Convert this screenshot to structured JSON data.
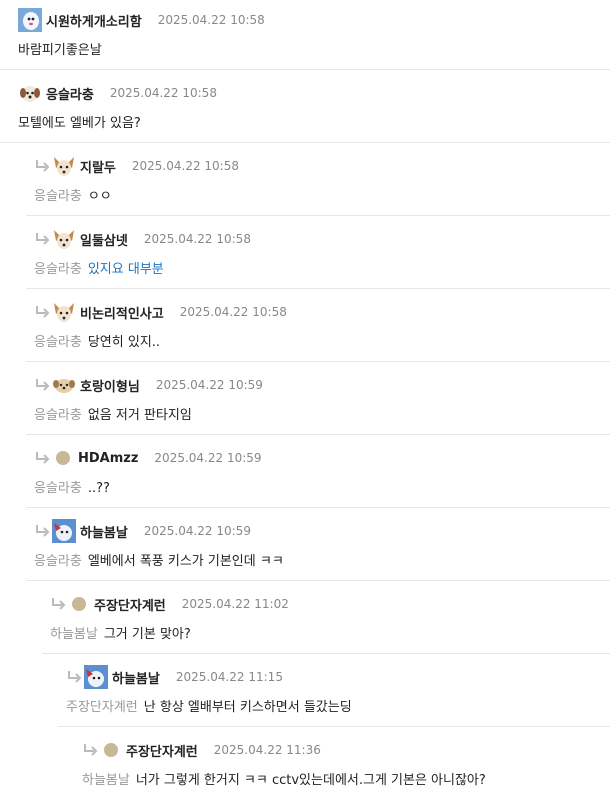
{
  "comments": [
    {
      "nick": "시원하게개소리함",
      "date": "2025.04.22 10:58",
      "mention": "",
      "text": "바람피기좋은날",
      "avatar": "ghost-bird-icon"
    },
    {
      "nick": "응슬라충",
      "date": "2025.04.22 10:58",
      "mention": "",
      "text": "모텔에도 엘베가 있음?",
      "avatar": "white-dog-icon"
    },
    {
      "nick": "지랄두",
      "date": "2025.04.22 10:58",
      "mention": "응슬라충",
      "text": "ㅇㅇ",
      "avatar": "chihuahua-icon"
    },
    {
      "nick": "일둘삼넷",
      "date": "2025.04.22 10:58",
      "mention": "응슬라충",
      "text": "있지요 대부분",
      "avatar": "chihuahua-icon"
    },
    {
      "nick": "비논리적인사고",
      "date": "2025.04.22 10:58",
      "mention": "응슬라충",
      "text": "당연히 있지..",
      "avatar": "chihuahua-icon"
    },
    {
      "nick": "호랑이형님",
      "date": "2025.04.22 10:59",
      "mention": "응슬라충",
      "text": "없음 저거 판타지임",
      "avatar": "puppy-icon"
    },
    {
      "nick": "HDAmzz",
      "date": "2025.04.22 10:59",
      "mention": "응슬라충",
      "text": "..??",
      "avatar": "default-dot"
    },
    {
      "nick": "하늘봄날",
      "date": "2025.04.22 10:59",
      "mention": "응슬라충",
      "text": "엘베에서 폭풍 키스가 기본인데 ㅋㅋ",
      "avatar": "sky-bird-icon"
    },
    {
      "nick": "주장단자계런",
      "date": "2025.04.22 11:02",
      "mention": "하늘봄날",
      "text": "그거 기본 맞아?",
      "avatar": "default-dot"
    },
    {
      "nick": "하늘봄날",
      "date": "2025.04.22 11:15",
      "mention": "주장단자계런",
      "text": "난 항상 엘배부터 키스하면서 들갔는딩",
      "avatar": "sky-bird-icon"
    },
    {
      "nick": "주장단자계런",
      "date": "2025.04.22 11:36",
      "mention": "하늘봄날",
      "text": "너가 그렇게 한거지 ㅋㅋ cctv있는데에서.그게 기본은 아니잖아?",
      "avatar": "default-dot"
    }
  ]
}
